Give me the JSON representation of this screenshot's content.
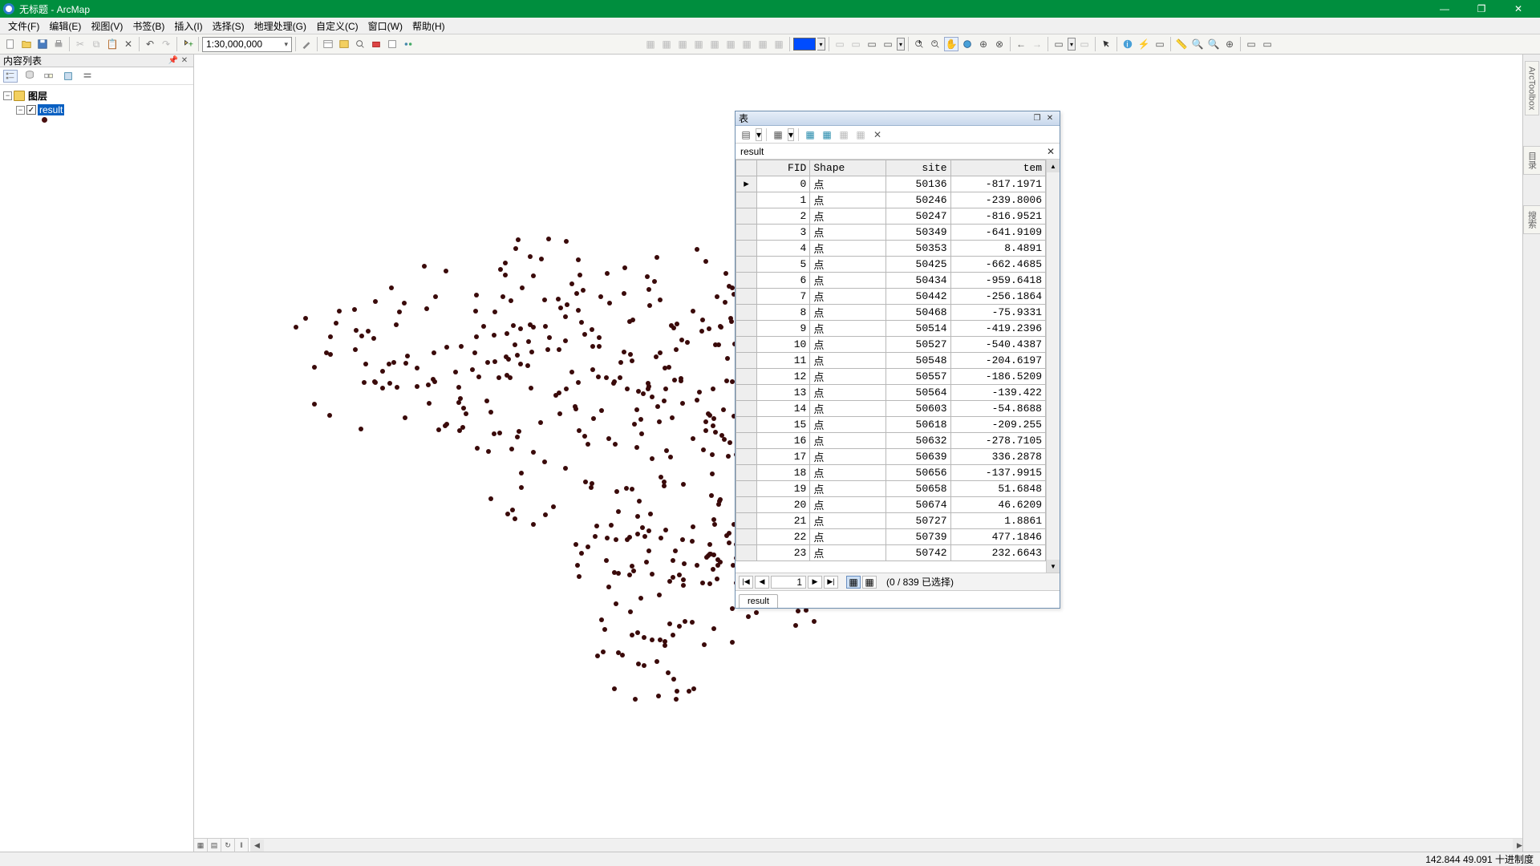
{
  "window": {
    "title": "无标题 - ArcMap",
    "min": "—",
    "max": "❐",
    "close": "✕"
  },
  "menu": {
    "file": "文件(F)",
    "edit": "编辑(E)",
    "view": "视图(V)",
    "bookmarks": "书签(B)",
    "insert": "插入(I)",
    "select": "选择(S)",
    "geoproc": "地理处理(G)",
    "customize": "自定义(C)",
    "windows": "窗口(W)",
    "help": "帮助(H)"
  },
  "toolbar": {
    "scale": "1:30,000,000"
  },
  "toc": {
    "title": "内容列表",
    "root": "图层",
    "layer": "result"
  },
  "docks": {
    "arctoolbox": "ArcToolbox",
    "catalog": "目录",
    "search": "搜索"
  },
  "table": {
    "title": "表",
    "name": "result",
    "tab": "result",
    "columns": {
      "fid": "FID",
      "shape": "Shape",
      "site": "site",
      "tem": "tem"
    },
    "shape_val": "点",
    "rows": [
      {
        "fid": 0,
        "site": 50136,
        "tem": "-817.1971"
      },
      {
        "fid": 1,
        "site": 50246,
        "tem": "-239.8006"
      },
      {
        "fid": 2,
        "site": 50247,
        "tem": "-816.9521"
      },
      {
        "fid": 3,
        "site": 50349,
        "tem": "-641.9109"
      },
      {
        "fid": 4,
        "site": 50353,
        "tem": "8.4891"
      },
      {
        "fid": 5,
        "site": 50425,
        "tem": "-662.4685"
      },
      {
        "fid": 6,
        "site": 50434,
        "tem": "-959.6418"
      },
      {
        "fid": 7,
        "site": 50442,
        "tem": "-256.1864"
      },
      {
        "fid": 8,
        "site": 50468,
        "tem": "-75.9331"
      },
      {
        "fid": 9,
        "site": 50514,
        "tem": "-419.2396"
      },
      {
        "fid": 10,
        "site": 50527,
        "tem": "-540.4387"
      },
      {
        "fid": 11,
        "site": 50548,
        "tem": "-204.6197"
      },
      {
        "fid": 12,
        "site": 50557,
        "tem": "-186.5209"
      },
      {
        "fid": 13,
        "site": 50564,
        "tem": "-139.422"
      },
      {
        "fid": 14,
        "site": 50603,
        "tem": "-54.8688"
      },
      {
        "fid": 15,
        "site": 50618,
        "tem": "-209.255"
      },
      {
        "fid": 16,
        "site": 50632,
        "tem": "-278.7105"
      },
      {
        "fid": 17,
        "site": 50639,
        "tem": "336.2878"
      },
      {
        "fid": 18,
        "site": 50656,
        "tem": "-137.9915"
      },
      {
        "fid": 19,
        "site": 50658,
        "tem": "51.6848"
      },
      {
        "fid": 20,
        "site": 50674,
        "tem": "46.6209"
      },
      {
        "fid": 21,
        "site": 50727,
        "tem": "1.8861"
      },
      {
        "fid": 22,
        "site": 50739,
        "tem": "477.1846"
      },
      {
        "fid": 23,
        "site": 50742,
        "tem": "232.6643"
      }
    ],
    "record": "1",
    "status": "(0 / 839 已选择)"
  },
  "status": {
    "coords": "142.844  49.091 十进制度"
  }
}
